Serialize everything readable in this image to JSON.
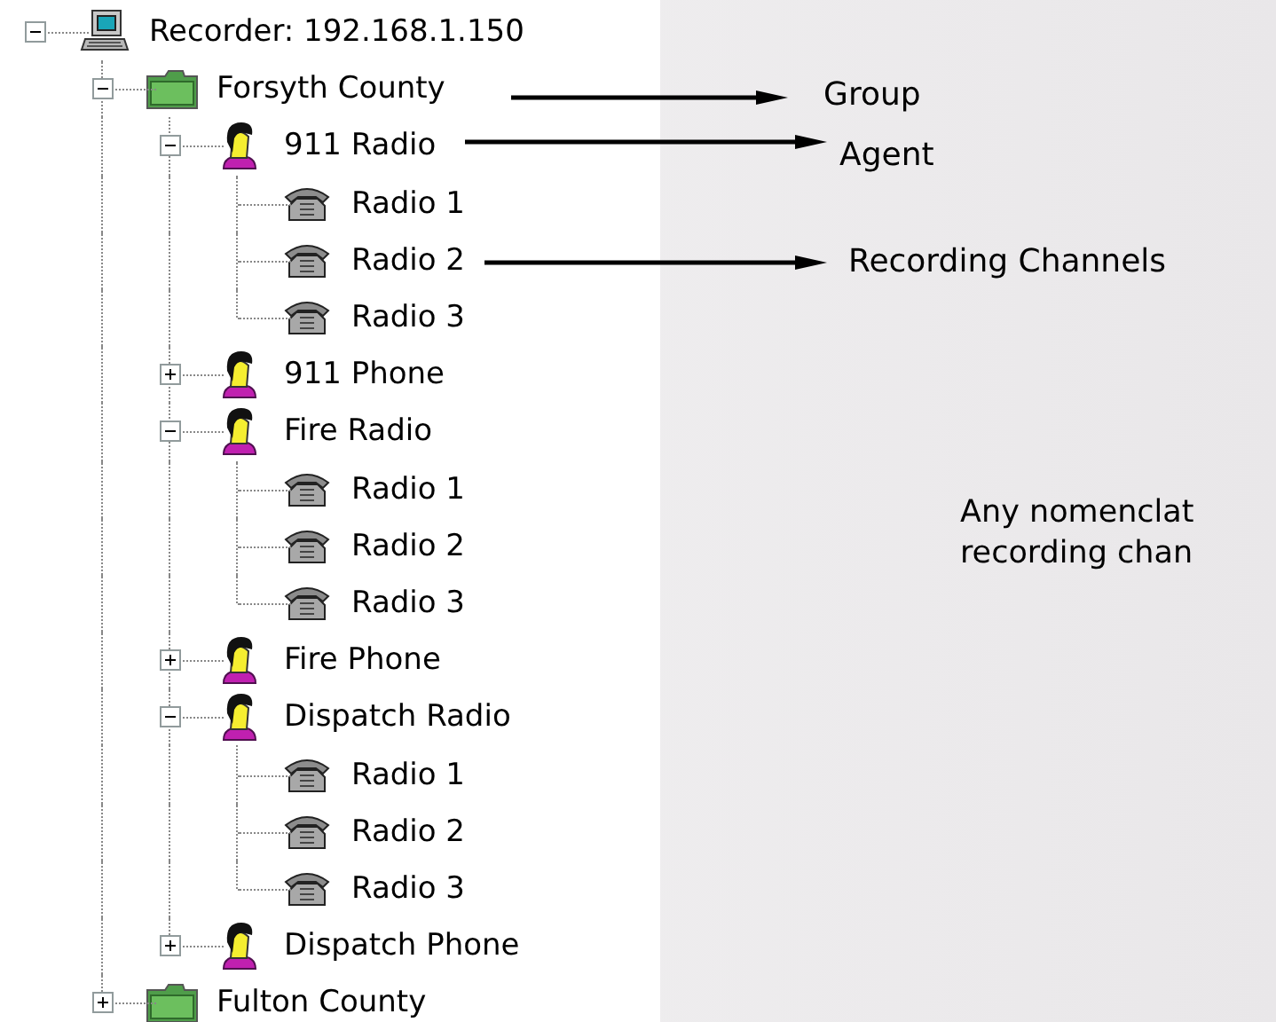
{
  "tree": {
    "nodes": [
      {
        "label": "Recorder: 192.168.1.150",
        "kind": "recorder",
        "expanded": true,
        "children": [
          {
            "label": "Forsyth County",
            "kind": "group",
            "expanded": true,
            "children": [
              {
                "label": "911 Radio",
                "kind": "agent",
                "expanded": true,
                "children": [
                  {
                    "label": "Radio 1",
                    "kind": "channel"
                  },
                  {
                    "label": "Radio 2",
                    "kind": "channel"
                  },
                  {
                    "label": "Radio 3",
                    "kind": "channel"
                  }
                ]
              },
              {
                "label": "911 Phone",
                "kind": "agent",
                "expanded": false
              },
              {
                "label": "Fire Radio",
                "kind": "agent",
                "expanded": true,
                "children": [
                  {
                    "label": "Radio 1",
                    "kind": "channel"
                  },
                  {
                    "label": "Radio 2",
                    "kind": "channel"
                  },
                  {
                    "label": "Radio 3",
                    "kind": "channel"
                  }
                ]
              },
              {
                "label": "Fire Phone",
                "kind": "agent",
                "expanded": false
              },
              {
                "label": "Dispatch Radio",
                "kind": "agent",
                "expanded": true,
                "children": [
                  {
                    "label": "Radio 1",
                    "kind": "channel"
                  },
                  {
                    "label": "Radio 2",
                    "kind": "channel"
                  },
                  {
                    "label": "Radio 3",
                    "kind": "channel"
                  }
                ]
              },
              {
                "label": "Dispatch Phone",
                "kind": "agent",
                "expanded": false
              }
            ]
          },
          {
            "label": "Fulton County",
            "kind": "group",
            "expanded": false
          }
        ]
      }
    ]
  },
  "annotations": [
    {
      "label": "Group"
    },
    {
      "label": "Agent"
    },
    {
      "label": "Recording Channels"
    }
  ],
  "note": {
    "lines": [
      "Any nomenclat",
      "recording chan"
    ]
  }
}
